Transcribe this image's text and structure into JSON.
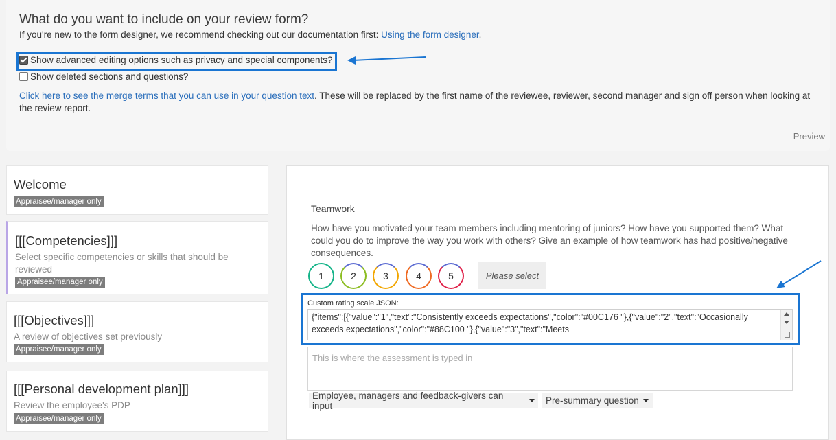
{
  "header": {
    "title": "What do you want to include on your review form?",
    "subtitle_prefix": "If you're new to the form designer, we recommend checking out our documentation first: ",
    "subtitle_link": "Using the form designer",
    "subtitle_suffix": "."
  },
  "options": {
    "advanced": {
      "label": "Show advanced editing options such as privacy and special components?",
      "checked": true
    },
    "deleted": {
      "label": "Show deleted sections and questions?",
      "checked": false
    }
  },
  "merge": {
    "link": "Click here to see the merge terms that you can use in your question text",
    "text": ". These will be replaced by the first name of the reviewee, reviewer, second manager and sign off person when looking at the review report."
  },
  "preview_label": "Preview",
  "sections": [
    {
      "title": "Welcome",
      "description": "",
      "badge": "Appraisee/manager only"
    },
    {
      "title": "[[[Competencies]]]",
      "description": "Select specific competencies or skills that should be reviewed",
      "badge": "Appraisee/manager only"
    },
    {
      "title": "[[[Objectives]]]",
      "description": "A review of objectives set previously",
      "badge": "Appraisee/manager only"
    },
    {
      "title": "[[[Personal development plan]]]",
      "description": "Review the employee's PDP",
      "badge": "Appraisee/manager only"
    }
  ],
  "editor": {
    "question_title": "Teamwork",
    "question_text": "How have you motivated your team members including mentoring of juniors? How have you supported them? What could you do to improve the way you work with others? Give an example of how teamwork has had positive/negative consequences.",
    "ratings": [
      "1",
      "2",
      "3",
      "4",
      "5"
    ],
    "please_select": "Please select",
    "json_label": "Custom rating scale JSON:",
    "json_value": "{\"items\":[{\"value\":\"1\",\"text\":\"Consistently exceeds expectations\",\"color\":\"#00C176 \"},{\"value\":\"2\",\"text\":\"Occasionally exceeds expectations\",\"color\":\"#88C100 \"},{\"value\":\"3\",\"text\":\"Meets",
    "assessment_placeholder": "This is where the assessment is typed in",
    "input_dropdown": "Employee, managers and feedback-givers can input",
    "summary_dropdown": "Pre-summary question"
  },
  "colors": {
    "highlight": "#1a75d2",
    "link": "#2a6ebb",
    "active_section_border": "#b9a6e6",
    "badge_bg": "#7d7d7d"
  }
}
